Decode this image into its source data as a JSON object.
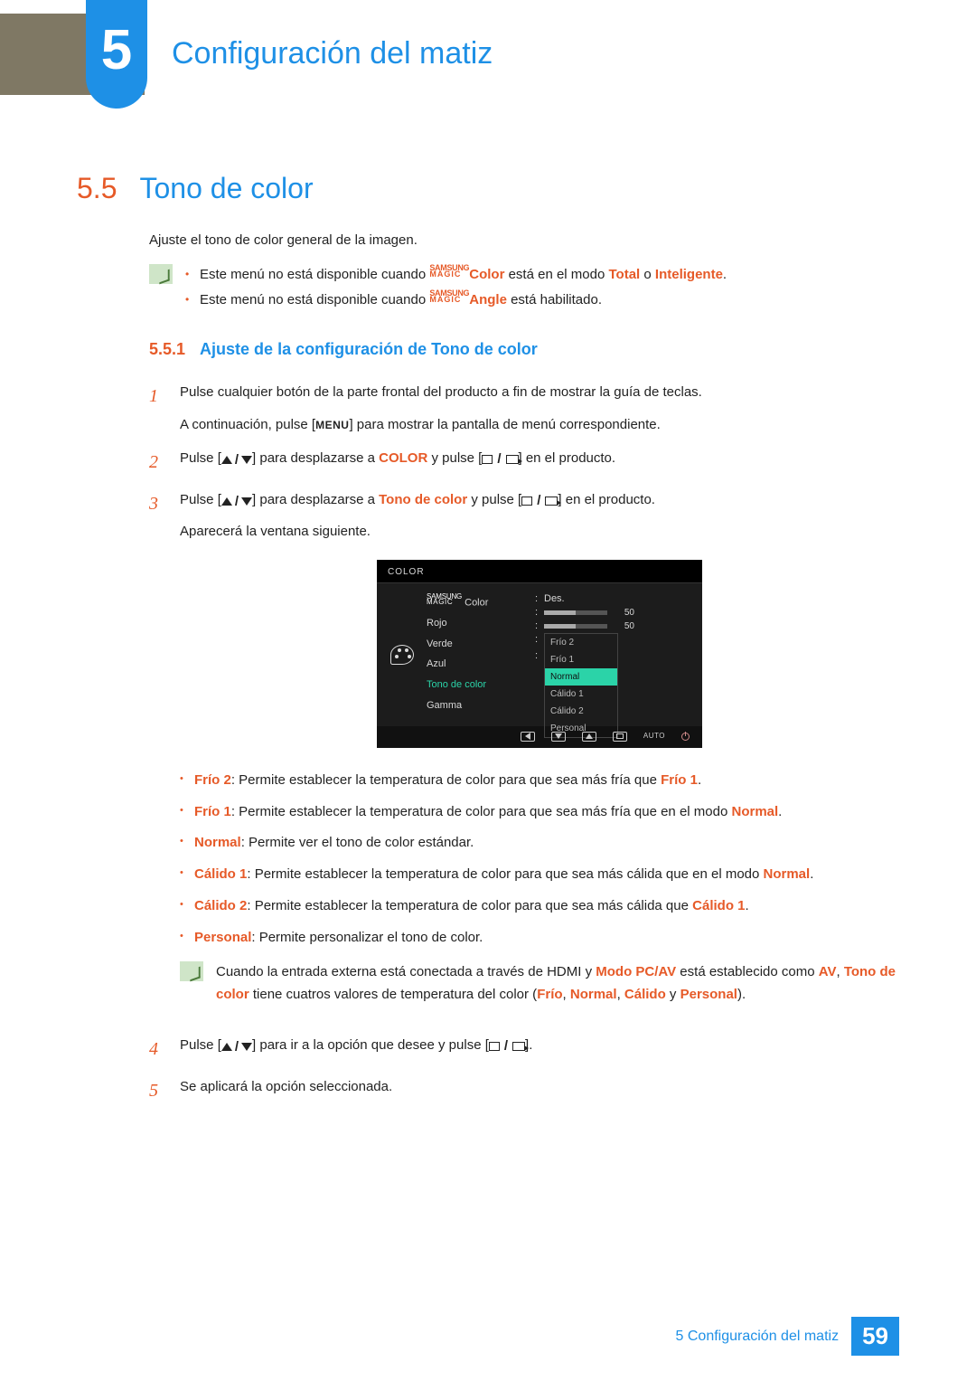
{
  "chapter": {
    "number": "5",
    "title": "Configuración del matiz"
  },
  "section": {
    "number": "5.5",
    "title": "Tono de color"
  },
  "intro": "Ajuste el tono de color general de la imagen.",
  "notes": {
    "n1": {
      "pre": "Este menú no está disponible cuando ",
      "brand_top": "SAMSUNG",
      "brand_bot": "MAGIC",
      "brand_suffix": "Color",
      "mid": " está en el modo ",
      "mode1": "Total",
      "or": " o ",
      "mode2": "Inteligente",
      "end": "."
    },
    "n2": {
      "pre": "Este menú no está disponible cuando ",
      "brand_top": "SAMSUNG",
      "brand_bot": "MAGIC",
      "brand_suffix": "Angle",
      "end": " está habilitado."
    }
  },
  "subsection": {
    "number": "5.5.1",
    "title": "Ajuste de la configuración de Tono de color"
  },
  "steps": {
    "s1a": "Pulse cualquier botón de la parte frontal del producto a fin de mostrar la guía de teclas.",
    "s1b_pre": "A continuación, pulse [",
    "s1b_menu": "MENU",
    "s1b_post": "] para mostrar la pantalla de menú correspondiente.",
    "s2_pre": "Pulse [",
    "s2_mid": "] para desplazarse a ",
    "s2_target": "COLOR",
    "s2_post": " y pulse [",
    "s2_end": "] en el producto.",
    "s3_pre": "Pulse [",
    "s3_mid": "] para desplazarse a ",
    "s3_target": "Tono de color",
    "s3_post": " y pulse [",
    "s3_end": "] en el producto.",
    "s3_after": "Aparecerá la ventana siguiente.",
    "s4_pre": "Pulse [",
    "s4_mid": "] para ir a la opción que desee y pulse [",
    "s4_end": "].",
    "s5": "Se aplicará la opción seleccionada."
  },
  "osd": {
    "title": "COLOR",
    "brand_top": "SAMSUNG",
    "brand_bot": "MAGIC",
    "brand_suffix": " Color",
    "items": {
      "rojo": "Rojo",
      "verde": "Verde",
      "azul": "Azul",
      "tono": "Tono de color",
      "gamma": "Gamma"
    },
    "value_des": "Des.",
    "value_50a": "50",
    "value_50b": "50",
    "options": {
      "frio2": "Frío 2",
      "frio1": "Frío 1",
      "normal": "Normal",
      "calido1": "Cálido 1",
      "calido2": "Cálido 2",
      "personal": "Personal"
    },
    "auto": "AUTO"
  },
  "descriptions": {
    "frio2": {
      "label": "Frío 2",
      "text": ": Permite establecer la temperatura de color para que sea más fría que ",
      "ref": "Frío 1",
      "end": "."
    },
    "frio1": {
      "label": "Frío 1",
      "text": ": Permite establecer la temperatura de color para que sea más fría que en el modo ",
      "ref": "Normal",
      "end": "."
    },
    "normal": {
      "label": "Normal",
      "text": ": Permite ver el tono de color estándar."
    },
    "calido1": {
      "label": "Cálido 1",
      "text": ": Permite establecer la temperatura de color para que sea más cálida que en el modo ",
      "ref": "Normal",
      "end": "."
    },
    "calido2": {
      "label": "Cálido 2",
      "text": ": Permite establecer la temperatura de color para que sea más cálida que ",
      "ref": "Cálido 1",
      "end": "."
    },
    "personal": {
      "label": "Personal",
      "text": ": Permite personalizar el tono de color."
    }
  },
  "hdmi_note": {
    "t1": "Cuando la entrada externa está conectada a través de HDMI y ",
    "modo": "Modo PC/AV",
    "t2": " está establecido como ",
    "av": "AV",
    "comma": ", ",
    "tono": "Tono de color",
    "t3": " tiene cuatros valores de temperatura del color (",
    "v1": "Frío",
    "v2": "Normal",
    "v3": "Cálido",
    "y": " y ",
    "v4": "Personal",
    "t4": ")."
  },
  "footer": {
    "crumb": "5 Configuración del matiz",
    "page": "59"
  }
}
